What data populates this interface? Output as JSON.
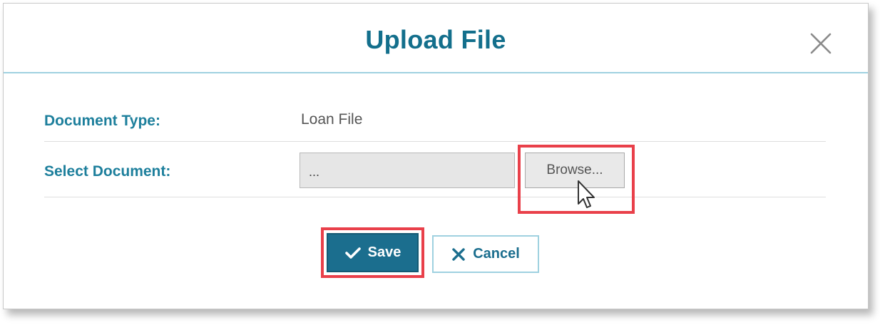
{
  "dialog": {
    "title": "Upload File"
  },
  "form": {
    "document_type": {
      "label": "Document Type:",
      "value": "Loan File"
    },
    "select_document": {
      "label": "Select Document:",
      "file_input_value": "...",
      "browse_label": "Browse..."
    }
  },
  "actions": {
    "save_label": "Save",
    "cancel_label": "Cancel"
  },
  "icons": {
    "close": "close-icon",
    "save": "checkmark-icon",
    "cancel": "x-icon",
    "cursor": "mouse-pointer-icon"
  },
  "colors": {
    "title": "#136f8c",
    "label": "#1d7f9c",
    "primary_button": "#1b6e8e",
    "header_divider": "#9fd1e0",
    "highlight": "#e9404a"
  }
}
